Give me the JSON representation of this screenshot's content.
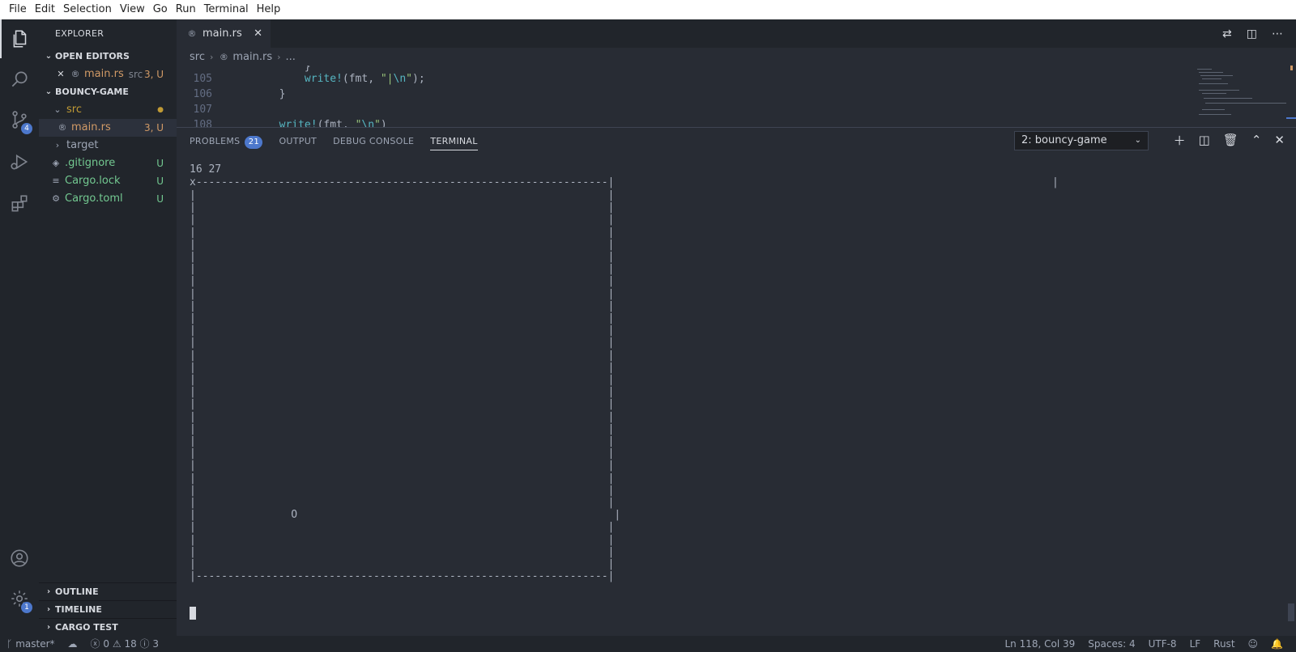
{
  "menu": [
    "File",
    "Edit",
    "Selection",
    "View",
    "Go",
    "Run",
    "Terminal",
    "Help"
  ],
  "activity": {
    "scm_badge": "4",
    "settings_badge": "1"
  },
  "sidebar": {
    "title": "EXPLORER",
    "open_editors": {
      "label": "OPEN EDITORS",
      "items": [
        {
          "name": "main.rs",
          "path": "src",
          "status": "3, U"
        }
      ]
    },
    "project": {
      "label": "BOUNCY-GAME",
      "tree": [
        {
          "name": "src",
          "status": "●"
        },
        {
          "name": "main.rs",
          "status": "3, U"
        },
        {
          "name": "target",
          "status": ""
        },
        {
          "name": ".gitignore",
          "status": "U"
        },
        {
          "name": "Cargo.lock",
          "status": "U"
        },
        {
          "name": "Cargo.toml",
          "status": "U"
        }
      ]
    },
    "bottom_sections": [
      "OUTLINE",
      "TIMELINE",
      "CARGO TEST"
    ]
  },
  "tab": {
    "label": "main.rs",
    "close": "✕"
  },
  "breadcrumb": [
    "src",
    "main.rs",
    "..."
  ],
  "code": [
    {
      "num": "105",
      "macro": "write!",
      "pre": "(fmt, ",
      "str_open": "\"|",
      "esc": "\\n",
      "str_close": "\"",
      "post": ");"
    },
    {
      "num": "106",
      "text": "}"
    },
    {
      "num": "107",
      "text": ""
    },
    {
      "num": "108",
      "macro": "write!",
      "pre": "(fmt, ",
      "str_open": "\"",
      "esc": "\\n",
      "str_close": "\"",
      "post": ")"
    }
  ],
  "panel": {
    "tabs": [
      "PROBLEMS",
      "OUTPUT",
      "DEBUG CONSOLE",
      "TERMINAL"
    ],
    "problems_count": "21",
    "active_tab": "TERMINAL",
    "terminal_select": "2: bouncy-game",
    "terminal": {
      "header": "16 27",
      "top_border": "x-----------------------------------------------------------------|",
      "bottom_border": "|-----------------------------------------------------------------|",
      "side_line": "|                                                                 |",
      "ball_line": "|               O                                                  |",
      "stray_bar": "|"
    }
  },
  "status": {
    "branch": "master*",
    "errors": "0",
    "warnings": "18",
    "infos": "3",
    "position": "Ln 118, Col 39",
    "spaces": "Spaces: 4",
    "encoding": "UTF-8",
    "eol": "LF",
    "language": "Rust"
  }
}
